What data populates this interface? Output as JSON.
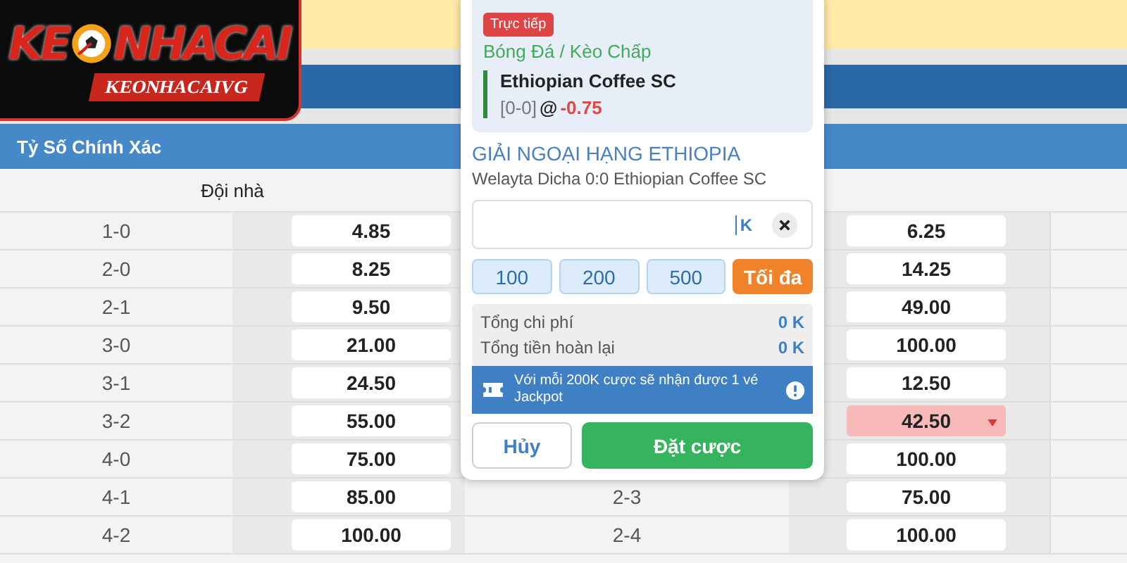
{
  "logo": {
    "title_left": "KE",
    "title_right": "NHACAI",
    "subtitle": "KEONHACAIVG"
  },
  "section_title": "Tỷ Số Chính Xác",
  "table": {
    "columns": [
      "Đội nhà"
    ],
    "rows": [
      {
        "score": "1-0",
        "odds": "4.85",
        "away_odds": "6.25",
        "selected": false,
        "dropping": false
      },
      {
        "score": "2-0",
        "odds": "8.25",
        "away_odds": "14.25",
        "selected": false,
        "dropping": false
      },
      {
        "score": "2-1",
        "odds": "9.50",
        "away_odds": "49.00",
        "selected": false,
        "dropping": false
      },
      {
        "score": "3-0",
        "odds": "21.00",
        "away_odds": "100.00",
        "selected": false,
        "dropping": false
      },
      {
        "score": "3-1",
        "odds": "24.50",
        "away_odds": "12.50",
        "selected": false,
        "dropping": false
      },
      {
        "score": "3-2",
        "odds": "55.00",
        "away_odds": "42.50",
        "selected": true,
        "dropping": true
      },
      {
        "score": "4-0",
        "odds": "75.00",
        "away_odds": "100.00",
        "selected": false,
        "dropping": false
      },
      {
        "score": "4-1",
        "odds": "85.00",
        "mid_score": "2-3",
        "away_odds": "75.00",
        "selected": false,
        "dropping": false
      },
      {
        "score": "4-2",
        "odds": "100.00",
        "mid_score": "2-4",
        "away_odds": "100.00",
        "selected": false,
        "dropping": false
      }
    ]
  },
  "bet_slip": {
    "badge": "Trực tiếp",
    "market": "Bóng Đá / Kèo Chấp",
    "selection": "Ethiopian Coffee SC",
    "current_score": "[0-0]",
    "at": "@",
    "odds": "-0.75",
    "league": "GIẢI NGOẠI HẠNG ETHIOPIA",
    "match": "Welayta Dicha 0:0 Ethiopian Coffee SC",
    "stake_suffix": "K",
    "chips": [
      {
        "label": "100",
        "kind": "amount"
      },
      {
        "label": "200",
        "kind": "amount"
      },
      {
        "label": "500",
        "kind": "amount"
      },
      {
        "label": "Tối đa",
        "kind": "max"
      }
    ],
    "summary": [
      {
        "label": "Tổng chi phí",
        "value": "0 K"
      },
      {
        "label": "Tổng tiền hoàn lại",
        "value": "0 K"
      }
    ],
    "promo": "Với mỗi 200K cược sẽ nhận được 1 vé Jackpot",
    "cancel": "Hủy",
    "submit": "Đặt cược"
  }
}
